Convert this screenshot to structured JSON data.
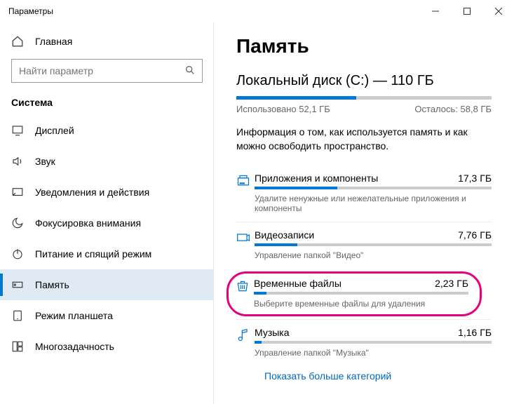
{
  "window": {
    "title": "Параметры"
  },
  "sidebar": {
    "home": "Главная",
    "searchPlaceholder": "Найти параметр",
    "section": "Система",
    "items": [
      {
        "label": "Дисплей"
      },
      {
        "label": "Звук"
      },
      {
        "label": "Уведомления и действия"
      },
      {
        "label": "Фокусировка внимания"
      },
      {
        "label": "Питание и спящий режим"
      },
      {
        "label": "Память"
      },
      {
        "label": "Режим планшета"
      },
      {
        "label": "Многозадачность"
      }
    ]
  },
  "page": {
    "heading": "Память",
    "diskName": "Локальный диск (C:) — 110 ГБ",
    "usedPct": 47,
    "usedLabel": "Использовано 52,1 ГБ",
    "freeLabel": "Осталось: 58,8 ГБ",
    "description": "Информация о том, как используется память и как можно освободить пространство.",
    "categories": [
      {
        "title": "Приложения и компоненты",
        "size": "17,3 ГБ",
        "desc": "Удалите ненужные или нежелательные приложения и компоненты",
        "pct": 35
      },
      {
        "title": "Видеозаписи",
        "size": "7,76 ГБ",
        "desc": "Управление папкой \"Видео\"",
        "pct": 18
      },
      {
        "title": "Временные файлы",
        "size": "2,23 ГБ",
        "desc": "Выберите временные файлы для удаления",
        "pct": 6
      },
      {
        "title": "Музыка",
        "size": "1,16 ГБ",
        "desc": "Управление папкой \"Музыка\"",
        "pct": 3
      }
    ],
    "showMore": "Показать больше категорий"
  }
}
